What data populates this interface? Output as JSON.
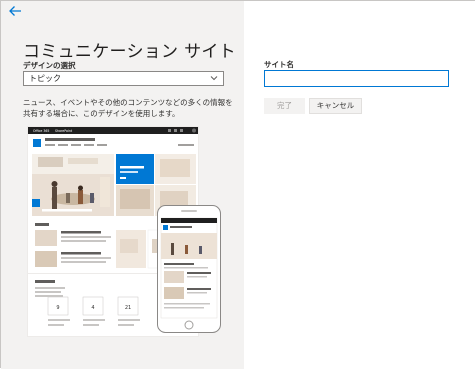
{
  "panel": {
    "title": "コミュニケーション サイト",
    "design_label": "デザインの選択",
    "design_selected": "トピック",
    "description": "ニュース、イベントやその他のコンテンツなどの多くの情報を共有する場合に、このデザインを使用します。"
  },
  "form": {
    "site_name_label": "サイト名",
    "site_name_value": "",
    "done_label": "完了",
    "cancel_label": "キャンセル"
  },
  "preview": {
    "suite_left": "Office 365",
    "suite_app": "SharePoint",
    "days": [
      "9",
      "4",
      "21"
    ]
  },
  "colors": {
    "accent": "#0078d4",
    "panel_bg": "#f3f2f1",
    "suite_bar": "#1f1f1f"
  },
  "icons": {
    "back": "back-arrow-icon",
    "dropdown": "chevron-down-icon"
  }
}
